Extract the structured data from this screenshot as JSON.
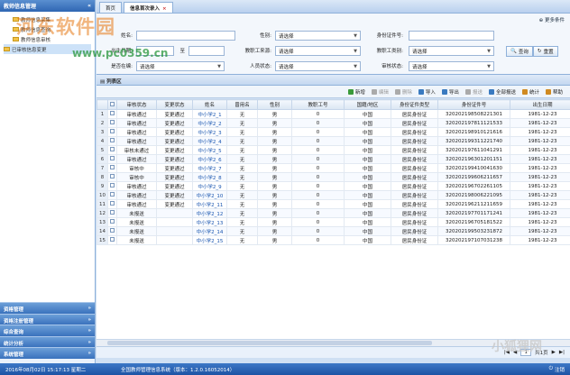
{
  "sidebar": {
    "title": "教师信息管理",
    "tree": [
      {
        "label": "教师信息采集",
        "level": 2
      },
      {
        "label": "教师信息查询",
        "level": 2
      },
      {
        "label": "教师信息审核",
        "level": 2
      },
      {
        "label": "已审核信息变更",
        "level": 1
      }
    ],
    "modules": [
      "资格管理",
      "资格注册管理",
      "综合查询",
      "统计分析",
      "系统管理"
    ]
  },
  "tabs": [
    {
      "label": "首页"
    },
    {
      "label": "信息首次录入"
    }
  ],
  "filter": {
    "more_label": "更多条件",
    "fields": [
      {
        "label": "姓名:",
        "value": ""
      },
      {
        "label": "性别:",
        "value": "请选择"
      },
      {
        "label": "身份证件号:",
        "value": ""
      },
      {
        "label": "出生日期:",
        "value": ""
      },
      {
        "label": "至",
        "value": ""
      },
      {
        "label": "教职工来源:",
        "value": "请选择"
      },
      {
        "label": "教职工类别:",
        "value": "请选择"
      },
      {
        "label": "是否在编:",
        "value": "请选择"
      },
      {
        "label": "人员状态:",
        "value": "请选择"
      },
      {
        "label": "审核状态:",
        "value": "请选择"
      }
    ],
    "query_label": "查询",
    "reset_label": "重置"
  },
  "list": {
    "title": "列表区",
    "toolbar": [
      {
        "label": "新增",
        "enabled": true,
        "color": "#3a9a3a"
      },
      {
        "label": "编辑",
        "enabled": false,
        "color": "#aaaaaa"
      },
      {
        "label": "删除",
        "enabled": false,
        "color": "#aaaaaa"
      },
      {
        "label": "导入",
        "enabled": true,
        "color": "#3a7ac0"
      },
      {
        "label": "导出",
        "enabled": true,
        "color": "#3a7ac0"
      },
      {
        "label": "报送",
        "enabled": false,
        "color": "#aaaaaa"
      },
      {
        "label": "全部报送",
        "enabled": true,
        "color": "#3a7ac0"
      },
      {
        "label": "统计",
        "enabled": true,
        "color": "#d08a20"
      },
      {
        "label": "帮助",
        "enabled": true,
        "color": "#d08a20"
      }
    ],
    "columns": [
      "",
      "",
      "审核状态",
      "变更状态",
      "姓名",
      "曾用名",
      "性别",
      "教职工号",
      "国籍/地区",
      "身份证件类型",
      "身份证件号",
      "出生日期"
    ],
    "rows": [
      [
        "1",
        "审核通过",
        "变更通过",
        "中小学2_1",
        "无",
        "男",
        "0",
        "中国",
        "居民身份证",
        "320202198508221301",
        "1981-12-23"
      ],
      [
        "2",
        "审核通过",
        "变更通过",
        "中小学2_2",
        "无",
        "男",
        "0",
        "中国",
        "居民身份证",
        "320202197811121533",
        "1981-12-23"
      ],
      [
        "3",
        "审核通过",
        "变更通过",
        "中小学2_3",
        "无",
        "男",
        "0",
        "中国",
        "居民身份证",
        "320202198910121616",
        "1981-12-23"
      ],
      [
        "4",
        "审核通过",
        "变更通过",
        "中小学2_4",
        "无",
        "男",
        "0",
        "中国",
        "居民身份证",
        "320202199311221740",
        "1981-12-23"
      ],
      [
        "5",
        "审核未通过",
        "变更通过",
        "中小学2_5",
        "无",
        "男",
        "0",
        "中国",
        "居民身份证",
        "320202197611041291",
        "1981-12-23"
      ],
      [
        "6",
        "审核通过",
        "变更通过",
        "中小学2_6",
        "无",
        "男",
        "0",
        "中国",
        "居民身份证",
        "320202196301201151",
        "1981-12-23"
      ],
      [
        "7",
        "审核中",
        "变更通过",
        "中小学2_7",
        "无",
        "男",
        "0",
        "中国",
        "居民身份证",
        "320202199410041630",
        "1981-12-23"
      ],
      [
        "8",
        "审核中",
        "变更通过",
        "中小学2_8",
        "无",
        "男",
        "0",
        "中国",
        "居民身份证",
        "320202199606211657",
        "1981-12-23"
      ],
      [
        "9",
        "审核通过",
        "变更通过",
        "中小学2_9",
        "无",
        "男",
        "0",
        "中国",
        "居民身份证",
        "320202196702261105",
        "1981-12-23"
      ],
      [
        "10",
        "审核通过",
        "变更通过",
        "中小学2_10",
        "无",
        "男",
        "0",
        "中国",
        "居民身份证",
        "320202198006221095",
        "1981-12-23"
      ],
      [
        "11",
        "审核通过",
        "变更通过",
        "中小学2_11",
        "无",
        "男",
        "0",
        "中国",
        "居民身份证",
        "320202196211211659",
        "1981-12-23"
      ],
      [
        "12",
        "未报送",
        "",
        "中小学2_12",
        "无",
        "男",
        "0",
        "中国",
        "居民身份证",
        "320202197701171241",
        "1981-12-23"
      ],
      [
        "13",
        "未报送",
        "",
        "中小学2_13",
        "无",
        "男",
        "0",
        "中国",
        "居民身份证",
        "320202196705181522",
        "1981-12-23"
      ],
      [
        "14",
        "未报送",
        "",
        "中小学2_14",
        "无",
        "男",
        "0",
        "中国",
        "居民身份证",
        "320202199503231872",
        "1981-12-23"
      ],
      [
        "15",
        "未报送",
        "",
        "中小学2_15",
        "无",
        "男",
        "0",
        "中国",
        "居民身份证",
        "320202197107031238",
        "1981-12-23"
      ]
    ]
  },
  "pager": {
    "page": "1",
    "total_label": "共1页"
  },
  "status": {
    "datetime": "2016年08月02日  15:17:13  星期二",
    "system": "全国教师管理信息系统（版本：1.2.0.16052014）",
    "logout": "注销"
  },
  "watermarks": [
    "河东软件园",
    "www.pc0359.cn",
    "小狐狸网"
  ]
}
